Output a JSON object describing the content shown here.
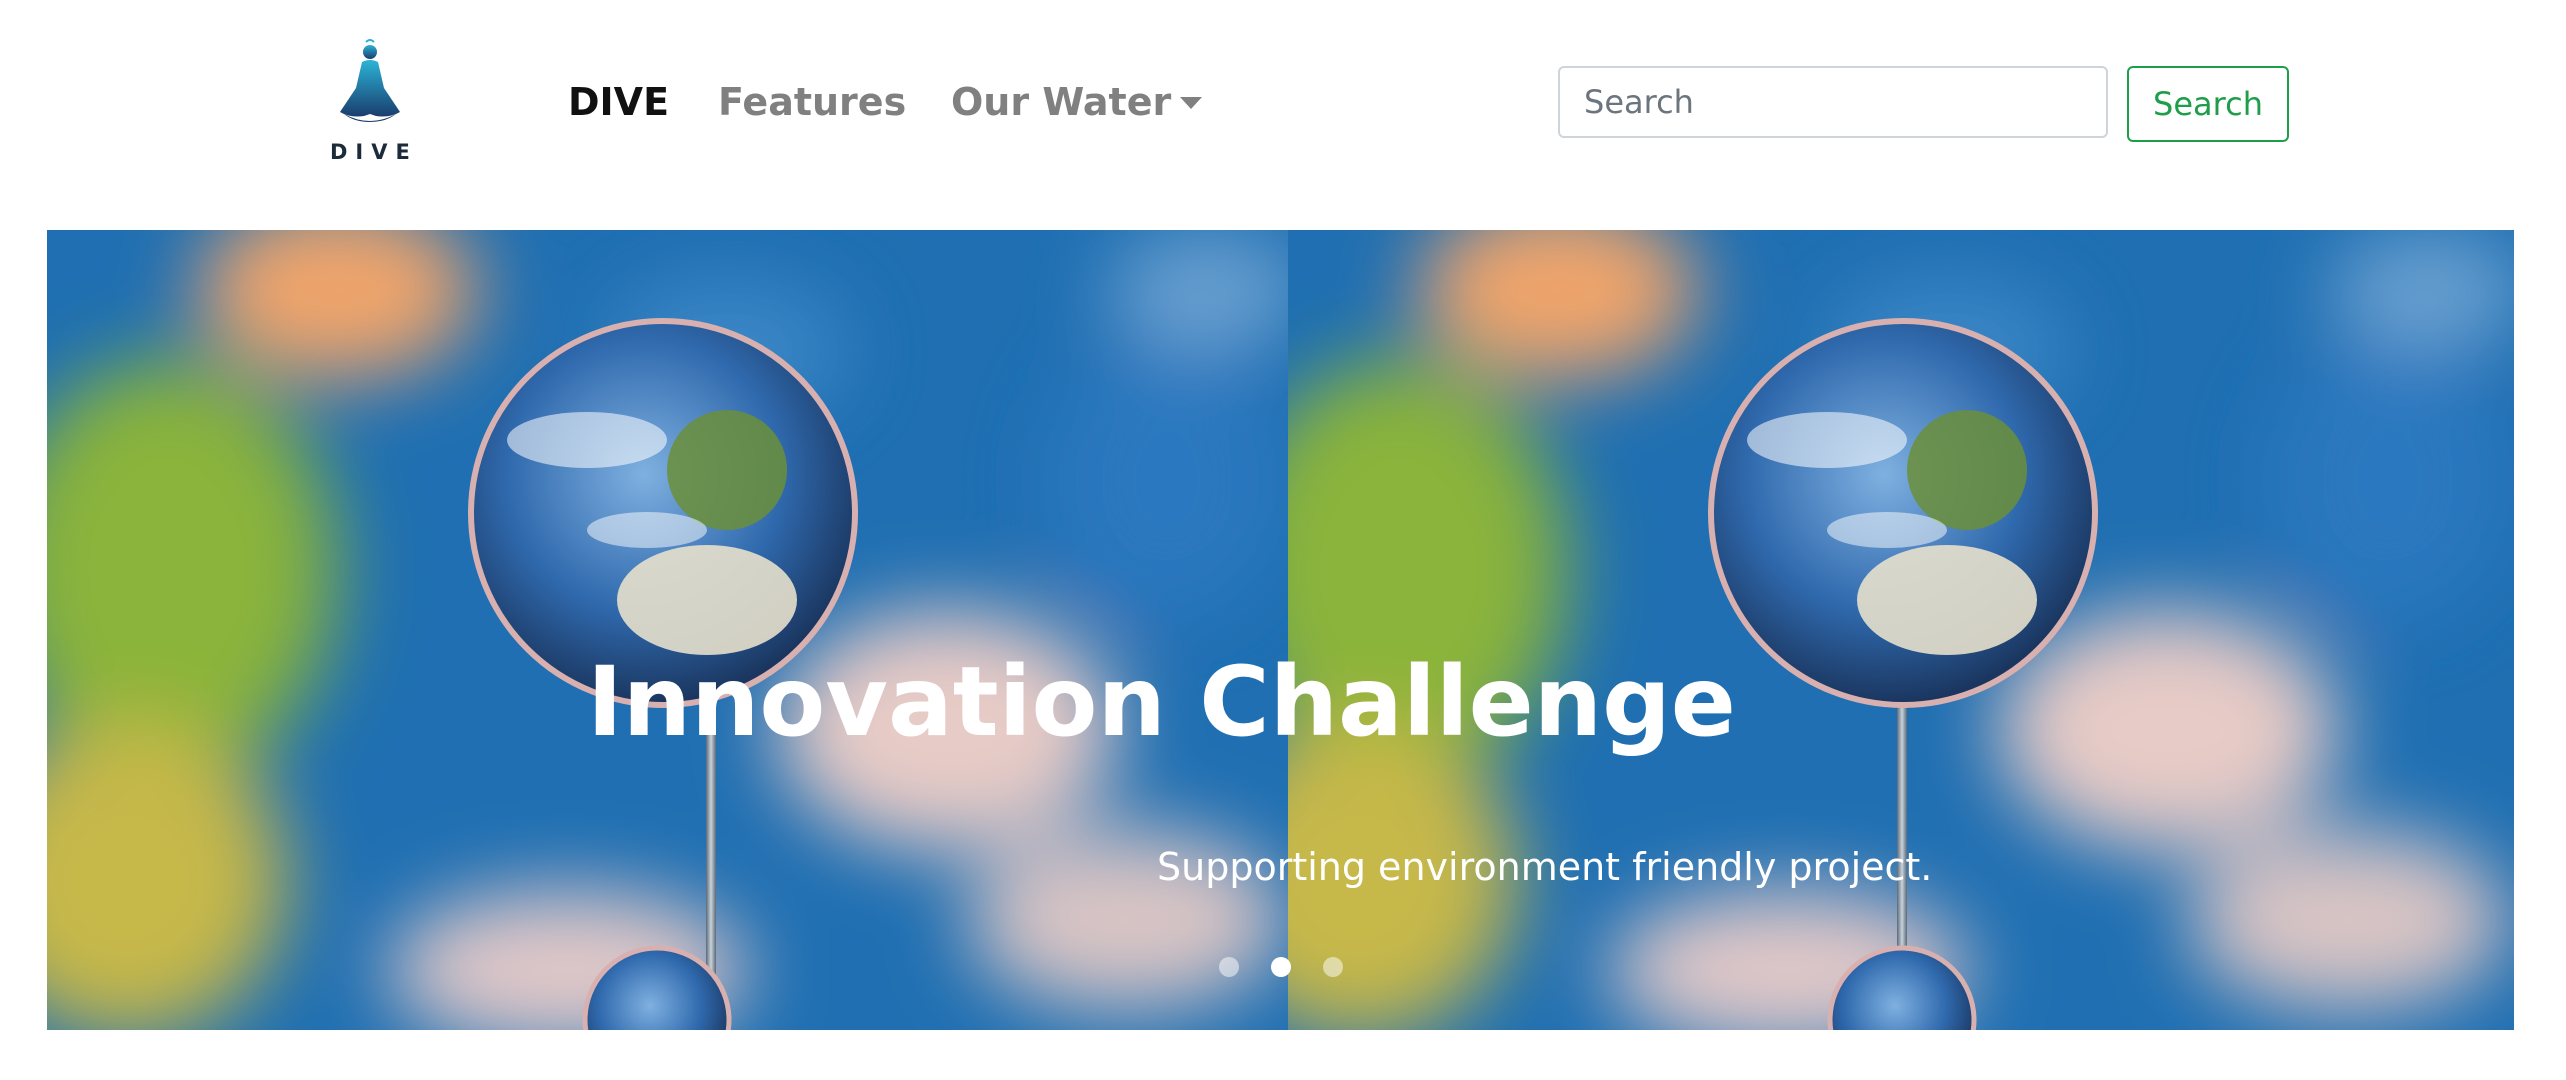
{
  "header": {
    "logo_text": "DIVE",
    "logo_icon": "meditating-diver-icon",
    "nav": {
      "brand_label": "DIVE",
      "features_label": "Features",
      "water_label": "Our Water"
    },
    "search": {
      "placeholder": "Search",
      "button_label": "Search"
    }
  },
  "carousel": {
    "title": "Innovation Challenge",
    "subtitle": "Supporting environment friendly project.",
    "slide_count": 3,
    "active_slide": 2
  },
  "colors": {
    "accent": "#1e9e4a",
    "nav_text": "#808080",
    "brand_text": "#111111"
  }
}
